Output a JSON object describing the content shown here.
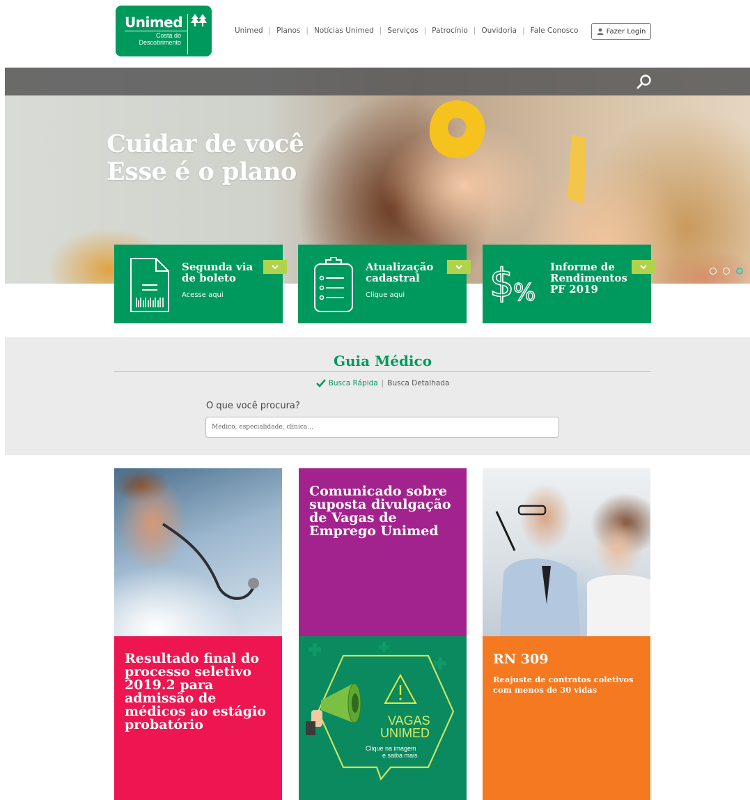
{
  "header": {
    "logo": {
      "name": "Unimed",
      "subtitle_line1": "Costa do",
      "subtitle_line2": "Descobrimento"
    },
    "nav": [
      "Unimed",
      "Planos",
      "Notícias Unimed",
      "Serviços",
      "Patrocínio",
      "Ouvidoria",
      "Fale Conosco"
    ],
    "login_label": "Fazer Login"
  },
  "hero": {
    "title_line1": "Cuidar de você",
    "title_line2": "Esse é o plano",
    "slide_count": 3,
    "active_slide": 3
  },
  "cards": [
    {
      "title_line1": "Segunda via",
      "title_line2": "de boleto",
      "subtitle": "Acesse aqui",
      "icon": "invoice-barcode-icon"
    },
    {
      "title_line1": "Atualização",
      "title_line2": "cadastral",
      "subtitle": "Clique aqui",
      "icon": "clipboard-list-icon"
    },
    {
      "title_line1": "Informe de",
      "title_line2": "Rendimentos",
      "title_line3": "PF 2019",
      "icon": "money-percent-icon"
    }
  ],
  "guia": {
    "title": "Guia Médico",
    "tab_quick": "Busca Rápida",
    "tab_detailed": "Busca Detalhada",
    "label": "O que você procura?",
    "placeholder": "Médico, especialidade, clínica..."
  },
  "tiles": {
    "resultado": {
      "lines": [
        "Resultado final do",
        "processo seletivo",
        "2019.2 para",
        "admissão de",
        "médicos ao estágio",
        "probatório"
      ]
    },
    "comunicado": {
      "lines": [
        "Comunicado sobre",
        "suposta divulgação",
        "de Vagas de",
        "Emprego Unimed"
      ]
    },
    "vagas": {
      "line1": "VAGAS",
      "line2": "UNIMED",
      "cta1": "Clique na imagem",
      "cta2": "e saiba mais"
    },
    "rn": {
      "title": "RN 309",
      "sub1": "Reajuste de contratos coletivos",
      "sub2": "com menos de 30 vidas"
    }
  },
  "colors": {
    "brand_green": "#00995d",
    "accent_lime": "#b1d34b",
    "tile_pink": "#ed1651",
    "tile_purple": "#a3238e",
    "tile_orange": "#f47920",
    "tile_dark_green": "#0a8a5e",
    "guia_bg": "#ebebeb"
  }
}
